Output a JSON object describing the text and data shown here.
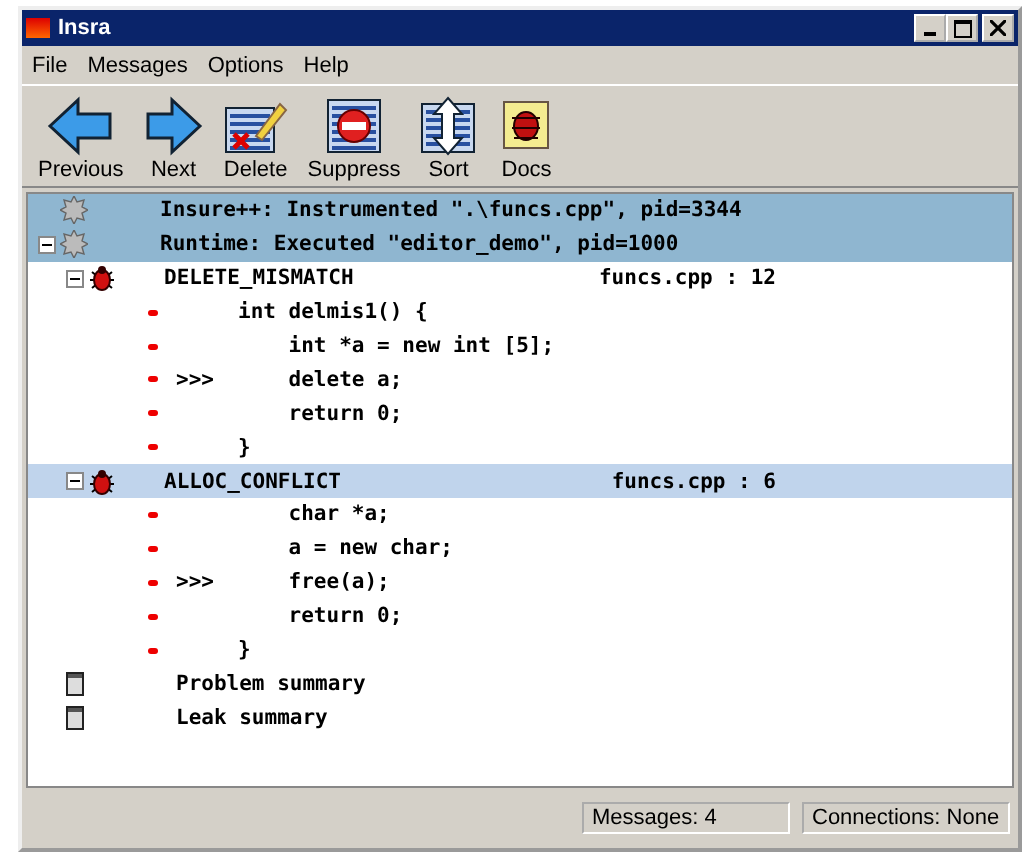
{
  "window": {
    "title": "Insra"
  },
  "menu": [
    "File",
    "Messages",
    "Options",
    "Help"
  ],
  "toolbar": [
    {
      "kind": "previous",
      "label": "Previous"
    },
    {
      "kind": "next",
      "label": "Next"
    },
    {
      "kind": "delete",
      "label": "Delete"
    },
    {
      "kind": "suppress",
      "label": "Suppress"
    },
    {
      "kind": "sort",
      "label": "Sort"
    },
    {
      "kind": "docs",
      "label": "Docs"
    }
  ],
  "messages": [
    {
      "kind": "session",
      "text": "Insure++: Instrumented \".\\funcs.cpp\", pid=3344",
      "toggle": false
    },
    {
      "kind": "session",
      "text": "Runtime: Executed \"editor_demo\", pid=1000",
      "toggle": true,
      "expanded": true
    },
    {
      "kind": "error",
      "name": "DELETE_MISMATCH",
      "location": "funcs.cpp : 12",
      "expanded": true,
      "selected": false,
      "lines": [
        {
          "code": "int delmis1() {"
        },
        {
          "code": "    int *a = new int [5];"
        },
        {
          "marker": ">>>",
          "code": "    delete a;"
        },
        {
          "code": "    return 0;"
        },
        {
          "code": "}"
        }
      ]
    },
    {
      "kind": "error",
      "name": "ALLOC_CONFLICT",
      "location": "funcs.cpp : 6",
      "expanded": true,
      "selected": true,
      "lines": [
        {
          "code": "    char *a;"
        },
        {
          "code": "    a = new char;"
        },
        {
          "marker": ">>>",
          "code": "    free(a);"
        },
        {
          "code": "    return 0;"
        },
        {
          "code": "}"
        }
      ]
    },
    {
      "kind": "summary",
      "text": "Problem summary"
    },
    {
      "kind": "summary",
      "text": "Leak summary"
    }
  ],
  "status_bar": [
    "Messages: 4",
    "Connections: None"
  ]
}
